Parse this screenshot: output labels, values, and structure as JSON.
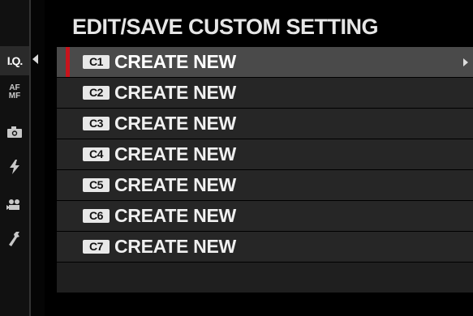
{
  "screen": {
    "title": "EDIT/SAVE CUSTOM SETTING"
  },
  "sidebar": {
    "tabs": [
      {
        "label": "I.Q.",
        "active": true
      },
      {
        "label_line1": "AF",
        "label_line2": "MF"
      },
      {
        "icon": "camera-icon"
      },
      {
        "icon": "flash-icon"
      },
      {
        "icon": "movie-icon"
      },
      {
        "icon": "wrench-icon"
      }
    ]
  },
  "menu": {
    "items": [
      {
        "badge": "C1",
        "label": "CREATE NEW",
        "selected": true
      },
      {
        "badge": "C2",
        "label": "CREATE NEW"
      },
      {
        "badge": "C3",
        "label": "CREATE NEW"
      },
      {
        "badge": "C4",
        "label": "CREATE NEW"
      },
      {
        "badge": "C5",
        "label": "CREATE NEW"
      },
      {
        "badge": "C6",
        "label": "CREATE NEW"
      },
      {
        "badge": "C7",
        "label": "CREATE NEW"
      }
    ]
  },
  "colors": {
    "background": "#000000",
    "row": "#262626",
    "row_selected": "#4a4a4a",
    "cursor": "#c8141c",
    "text": "#f0f0f0"
  }
}
